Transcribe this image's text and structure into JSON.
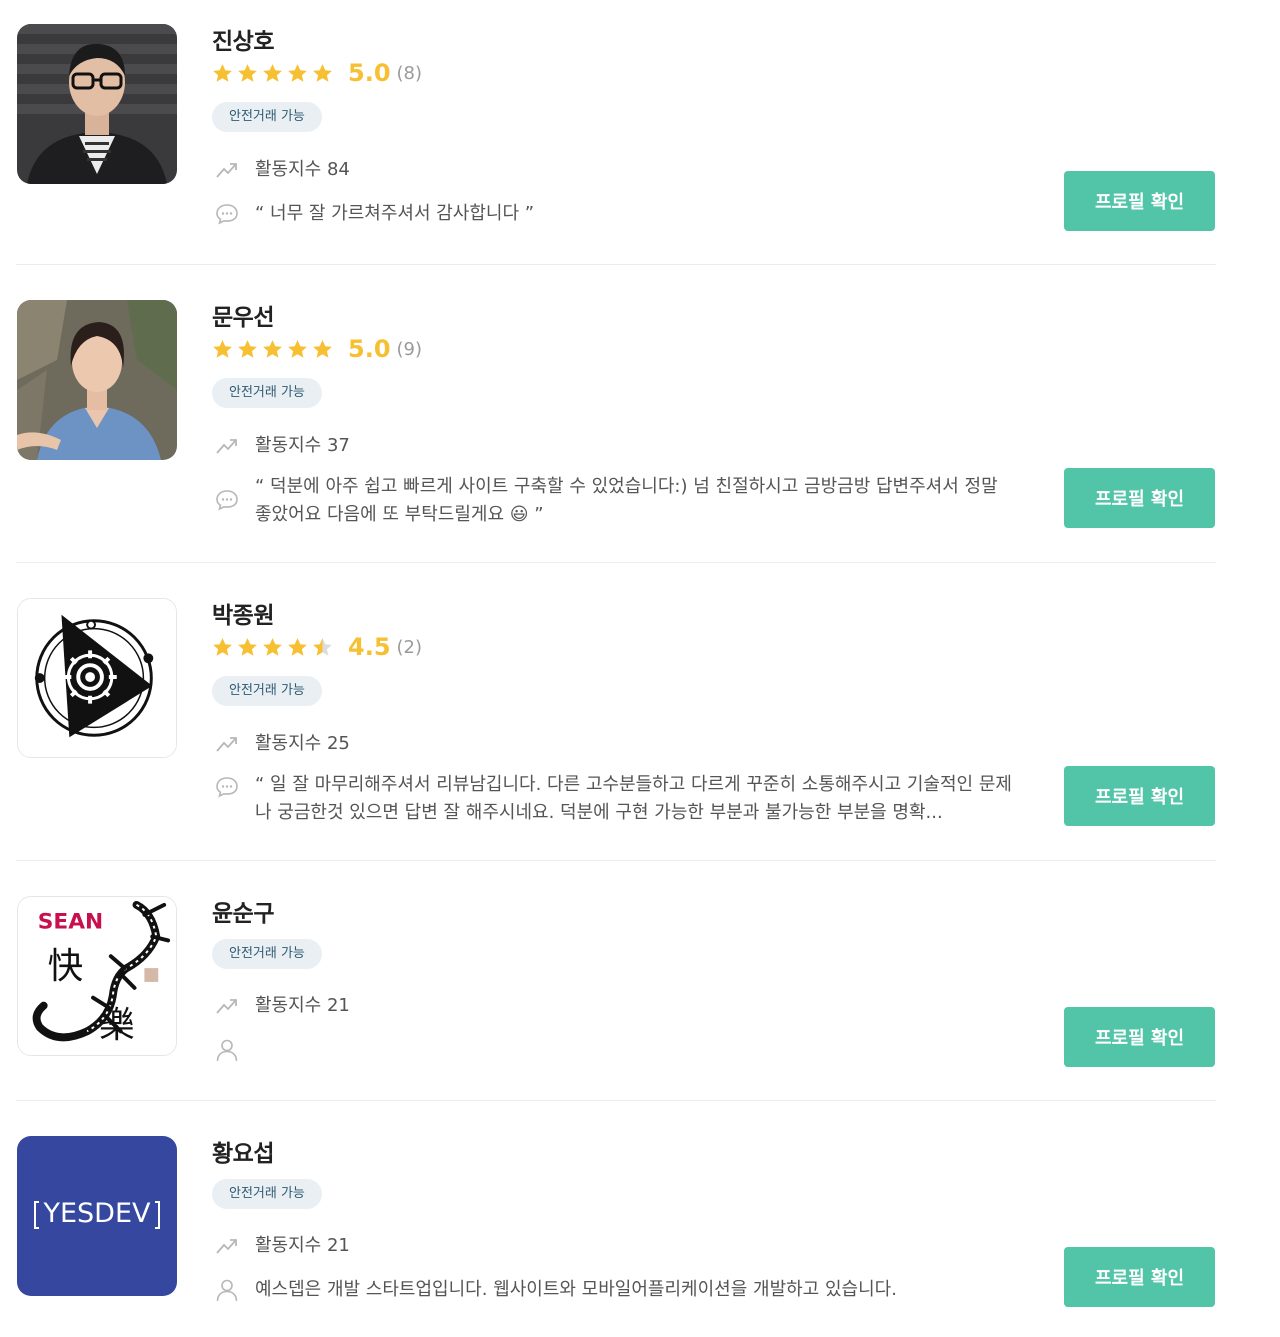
{
  "cards": [
    {
      "name": "진상호",
      "rating": "5.0",
      "review_count": "(8)",
      "stars": 5,
      "badge": "안전거래 가능",
      "activity_label": "활동지수 84",
      "quote": "“ 너무 잘 가르쳐주셔서 감사합니다 ”",
      "button": "프로필 확인"
    },
    {
      "name": "문우선",
      "rating": "5.0",
      "review_count": "(9)",
      "stars": 5,
      "badge": "안전거래 가능",
      "activity_label": "활동지수 37",
      "quote": "“ 덕분에 아주 쉽고 빠르게 사이트 구축할 수 있었습니다:) 넘 친절하시고 금방금방 답변주셔서 정말 좋았어요 다음에 또 부탁드릴게요 😃 ”",
      "button": "프로필 확인"
    },
    {
      "name": "박종원",
      "rating": "4.5",
      "review_count": "(2)",
      "stars": 4.5,
      "badge": "안전거래 가능",
      "activity_label": "활동지수 25",
      "quote": "“ 일 잘 마무리해주셔서 리뷰남깁니다. 다른 고수분들하고 다르게 꾸준히 소통해주시고 기술적인 문제나 궁금한것 있으면 답변 잘 해주시네요. 덕분에 구현 가능한 부분과 불가능한 부분을 명확...",
      "button": "프로필 확인"
    },
    {
      "name": "윤순구",
      "badge": "안전거래 가능",
      "activity_label": "활동지수 21",
      "intro": "",
      "button": "프로필 확인"
    },
    {
      "name": "황요섭",
      "badge": "안전거래 가능",
      "activity_label": "활동지수 21",
      "intro": "예스뎁은 개발 스타트업입니다. 웹사이트와 모바일어플리케이션을 개발하고 있습니다.",
      "logo_text": "YESDEV",
      "button": "프로필 확인"
    }
  ],
  "logos": {
    "sean_text": "SEAN"
  },
  "colors": {
    "accent_button": "#52c4a7",
    "star": "#f7c033",
    "badge_bg": "#e9eff3",
    "yesdev_bg": "#35479f"
  },
  "icons": {
    "activity": "trend-up-icon",
    "review": "speech-bubble-icon",
    "intro": "person-icon",
    "rating": "star-icon"
  }
}
